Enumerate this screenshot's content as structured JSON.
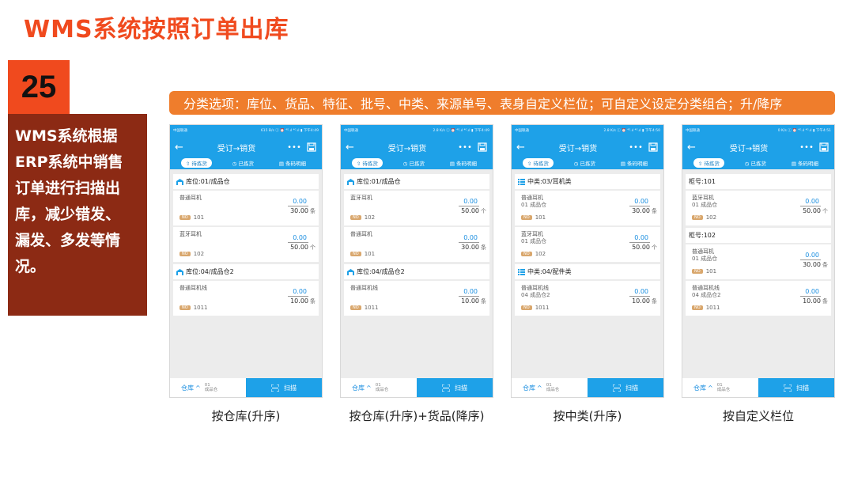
{
  "slide": {
    "title": "WMS系统按照订单出库",
    "number": "25",
    "side_lines": [
      "WMS系统根据",
      "ERP系统中销售",
      "订单进行扫描出",
      "库，减少错发、",
      "漏发、多发等情",
      "况。"
    ],
    "banner": "分类选项：库位、货品、特征、批号、中类、来源单号、表身自定义栏位；可自定义设定分类组合；升/降序"
  },
  "colors": {
    "accent": "#f04a1e",
    "panel": "#8c2a14",
    "banner": "#ef7d2c",
    "app_blue": "#1ea1e8"
  },
  "phones": [
    {
      "status": {
        "left": "中国联通",
        "right": "615 B/s ⓘ ⏰ ⁴ᴳ.ıl ⁴ᴳ.ıl ▮ 下午4:49"
      },
      "nav": {
        "title": "受订→销货",
        "more": "•••"
      },
      "tabs": [
        "待拣货",
        "已拣货",
        "条码明细"
      ],
      "groups": [
        {
          "header": "库位:01/成品仓",
          "icon": "warehouse-icon",
          "items": [
            {
              "name": "普通耳机",
              "warehouse": "",
              "code": "101",
              "scanned": "0.00",
              "total": "30.00",
              "unit": "条"
            },
            {
              "name": "蓝牙耳机",
              "warehouse": "",
              "code": "102",
              "scanned": "0.00",
              "total": "50.00",
              "unit": "个"
            }
          ]
        },
        {
          "header": "库位:04/成品仓2",
          "icon": "warehouse-icon",
          "items": [
            {
              "name": "普通耳机线",
              "warehouse": "",
              "code": "1011",
              "scanned": "0.00",
              "total": "10.00",
              "unit": "条"
            }
          ]
        }
      ],
      "footer": {
        "left": "仓库",
        "caret": "^",
        "sub1": "01",
        "sub2": "成品仓",
        "scan": "扫描"
      },
      "caption": "按仓库(升序)"
    },
    {
      "status": {
        "left": "中国联通",
        "right": "2.8 K/s ⓘ ⏰ ⁴ᴳ.ıl ⁴ᴳ.ıl ▮ 下午4:49"
      },
      "nav": {
        "title": "受订→销货",
        "more": "•••"
      },
      "tabs": [
        "待拣货",
        "已拣货",
        "条码明细"
      ],
      "groups": [
        {
          "header": "库位:01/成品仓",
          "icon": "warehouse-icon",
          "items": [
            {
              "name": "蓝牙耳机",
              "warehouse": "",
              "code": "102",
              "scanned": "0.00",
              "total": "50.00",
              "unit": "个"
            },
            {
              "name": "普通耳机",
              "warehouse": "",
              "code": "101",
              "scanned": "0.00",
              "total": "30.00",
              "unit": "条"
            }
          ]
        },
        {
          "header": "库位:04/成品仓2",
          "icon": "warehouse-icon",
          "items": [
            {
              "name": "普通耳机线",
              "warehouse": "",
              "code": "1011",
              "scanned": "0.00",
              "total": "10.00",
              "unit": "条"
            }
          ]
        }
      ],
      "footer": {
        "left": "仓库",
        "caret": "^",
        "sub1": "01",
        "sub2": "成品仓",
        "scan": "扫描"
      },
      "caption": "按仓库(升序)+货品(降序)"
    },
    {
      "status": {
        "left": "中国联通",
        "right": "2.8 K/s ⓘ ⏰ ⁴ᴳ.ıl ⁴ᴳ.ıl ▮ 下午4:50"
      },
      "nav": {
        "title": "受订→销货",
        "more": "•••"
      },
      "tabs": [
        "待拣货",
        "已拣货",
        "条码明细"
      ],
      "groups": [
        {
          "header": "中类:03/耳机类",
          "icon": "list-icon",
          "items": [
            {
              "name": "普通耳机",
              "warehouse": "01 成品仓",
              "code": "101",
              "scanned": "0.00",
              "total": "30.00",
              "unit": "条"
            },
            {
              "name": "蓝牙耳机",
              "warehouse": "01 成品仓",
              "code": "102",
              "scanned": "0.00",
              "total": "50.00",
              "unit": "个"
            }
          ]
        },
        {
          "header": "中类:04/配件类",
          "icon": "list-icon",
          "items": [
            {
              "name": "普通耳机线",
              "warehouse": "04 成品仓2",
              "code": "1011",
              "scanned": "0.00",
              "total": "10.00",
              "unit": "条"
            }
          ]
        }
      ],
      "footer": {
        "left": "仓库",
        "caret": "^",
        "sub1": "01",
        "sub2": "成品仓",
        "scan": "扫描"
      },
      "caption": "按中类(升序)"
    },
    {
      "status": {
        "left": "中国联通",
        "right": "0 K/s ⓘ ⏰ ⁴ᴳ.ıl ⁴ᴳ.ıl ▮ 下午4:51"
      },
      "nav": {
        "title": "受订→销货",
        "more": "•••"
      },
      "tabs": [
        "待拣货",
        "已拣货",
        "条码明细"
      ],
      "groups": [
        {
          "header": "柜号:101",
          "icon": "",
          "items": [
            {
              "name": "蓝牙耳机",
              "warehouse": "01 成品仓",
              "code": "102",
              "scanned": "0.00",
              "total": "50.00",
              "unit": "个"
            }
          ]
        },
        {
          "header": "柜号:102",
          "icon": "",
          "items": [
            {
              "name": "普通耳机",
              "warehouse": "01 成品仓",
              "code": "101",
              "scanned": "0.00",
              "total": "30.00",
              "unit": "条"
            },
            {
              "name": "普通耳机线",
              "warehouse": "04 成品仓2",
              "code": "1011",
              "scanned": "0.00",
              "total": "10.00",
              "unit": "条"
            }
          ]
        }
      ],
      "footer": {
        "left": "仓库",
        "caret": "^",
        "sub1": "01",
        "sub2": "成品仓",
        "scan": "扫描"
      },
      "caption": "按自定义栏位"
    }
  ]
}
